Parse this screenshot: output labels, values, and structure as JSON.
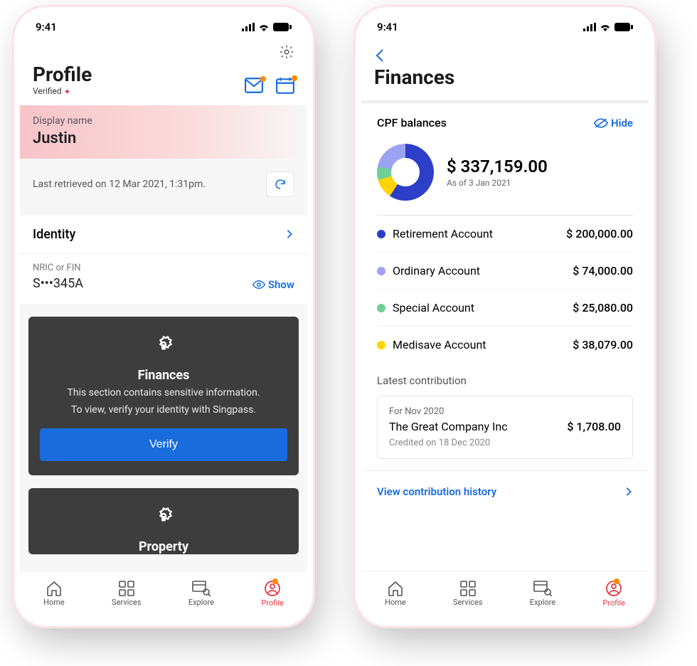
{
  "status": {
    "time": "9:41"
  },
  "phone1": {
    "title": "Profile",
    "verified": "Verified",
    "displayName": {
      "label": "Display name",
      "value": "Justin"
    },
    "retrieved": "Last retrieved on 12 Mar 2021, 1:31pm.",
    "identity": {
      "heading": "Identity",
      "nricLabel": "NRIC or FIN",
      "nricValue": "S•••345A",
      "show": "Show"
    },
    "finances": {
      "title": "Finances",
      "msg1": "This section contains sensitive information.",
      "msg2": "To view, verify your identity with Singpass.",
      "verify": "Verify"
    },
    "property": {
      "title": "Property"
    }
  },
  "phone2": {
    "title": "Finances",
    "cpf": {
      "label": "CPF balances",
      "hide": "Hide",
      "total": "$ 337,159.00",
      "asOf": "As of 3 Jan 2021",
      "accounts": [
        {
          "color": "#2d3ec8",
          "name": "Retirement Account",
          "amount": "$ 200,000.00"
        },
        {
          "color": "#9ca3f2",
          "name": "Ordinary Account",
          "amount": "$ 74,000.00"
        },
        {
          "color": "#6fcf97",
          "name": "Special Account",
          "amount": "$ 25,080.00"
        },
        {
          "color": "#ffd400",
          "name": "Medisave Account",
          "amount": "$ 38,079.00"
        }
      ]
    },
    "latest": {
      "label": "Latest contribution",
      "period": "For Nov 2020",
      "company": "The Great Company Inc",
      "amount": "$ 1,708.00",
      "credited": "Credited on 18 Dec 2020"
    },
    "viewHistory": "View contribution history"
  },
  "tabs": {
    "home": "Home",
    "services": "Services",
    "explore": "Explore",
    "profile": "Profile"
  },
  "chart_data": {
    "type": "pie",
    "title": "CPF balances",
    "series": [
      {
        "name": "Retirement Account",
        "value": 200000.0,
        "color": "#2d3ec8"
      },
      {
        "name": "Ordinary Account",
        "value": 74000.0,
        "color": "#9ca3f2"
      },
      {
        "name": "Special Account",
        "value": 25080.0,
        "color": "#6fcf97"
      },
      {
        "name": "Medisave Account",
        "value": 38079.0,
        "color": "#ffd400"
      }
    ],
    "total": 337159.0,
    "as_of": "3 Jan 2021"
  }
}
